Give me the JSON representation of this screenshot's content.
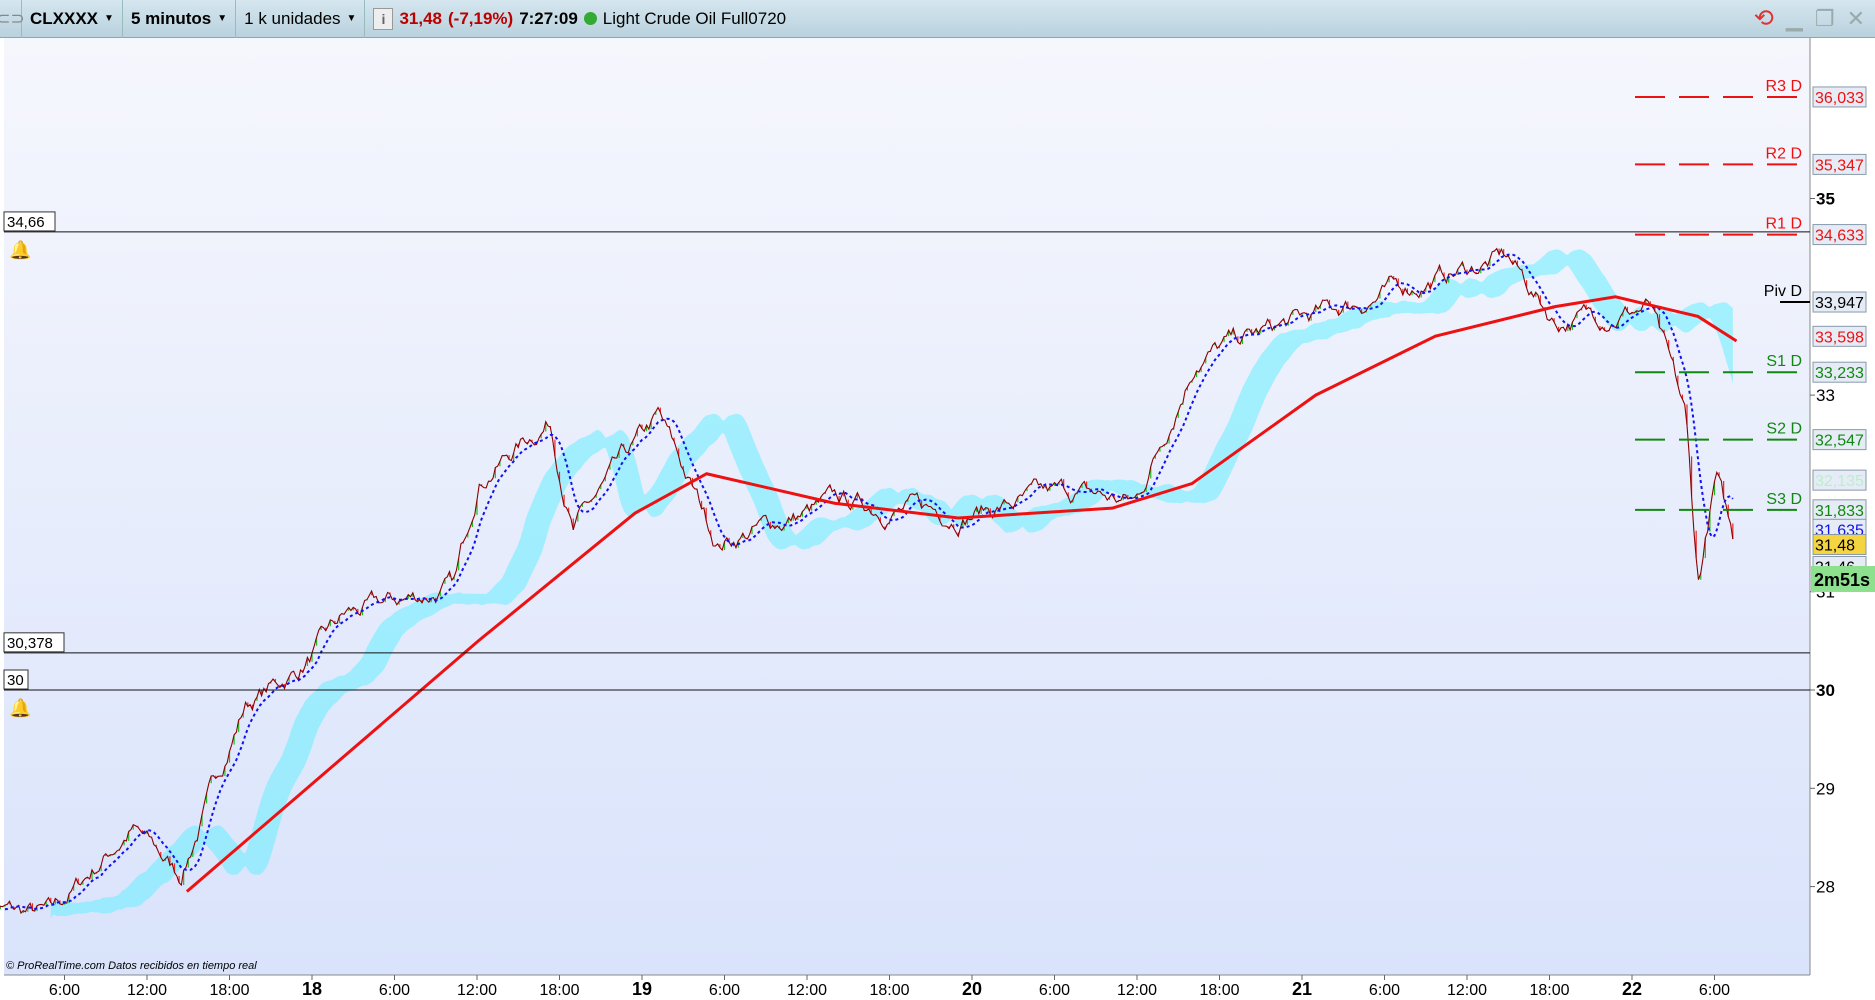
{
  "toolbar": {
    "instrument": "CLXXXX",
    "timeframe": "5 minutos",
    "units": "1 k unidades",
    "price": "31,48",
    "change": "(-7,19%)",
    "time": "7:27:09",
    "name": "Light Crude Oil Full0720"
  },
  "footer": {
    "copyright": "© ProRealTime.com",
    "realtime": "Datos recibidos en tiempo real"
  },
  "countdown": "2m51s",
  "colors": {
    "price": "#8b0000",
    "ma": "#ee1111",
    "tenkan": "#1111ee",
    "resistance": "#ee1111",
    "support": "#118811",
    "cloud_up": "#66eeff",
    "cloud_dn": "#88ee99"
  },
  "chart_data": {
    "type": "line",
    "x_unit": "hours since day 17 00:00",
    "x_ticks": [
      {
        "h": 6,
        "label": "6:00"
      },
      {
        "h": 12,
        "label": "12:00"
      },
      {
        "h": 18,
        "label": "18:00"
      },
      {
        "h": 24,
        "label": "18",
        "bold": true
      },
      {
        "h": 30,
        "label": "6:00"
      },
      {
        "h": 36,
        "label": "12:00"
      },
      {
        "h": 42,
        "label": "18:00"
      },
      {
        "h": 48,
        "label": "19",
        "bold": true
      },
      {
        "h": 54,
        "label": "6:00"
      },
      {
        "h": 60,
        "label": "12:00"
      },
      {
        "h": 66,
        "label": "18:00"
      },
      {
        "h": 72,
        "label": "20",
        "bold": true
      },
      {
        "h": 78,
        "label": "6:00"
      },
      {
        "h": 84,
        "label": "12:00"
      },
      {
        "h": 90,
        "label": "18:00"
      },
      {
        "h": 96,
        "label": "21",
        "bold": true
      },
      {
        "h": 102,
        "label": "6:00"
      },
      {
        "h": 108,
        "label": "12:00"
      },
      {
        "h": 114,
        "label": "18:00"
      },
      {
        "h": 120,
        "label": "22",
        "bold": true
      },
      {
        "h": 126,
        "label": "6:00"
      }
    ],
    "y_ticks": [
      {
        "v": 35,
        "label": "35",
        "bold": true
      },
      {
        "v": 33,
        "label": "33"
      },
      {
        "v": 31,
        "label": "31"
      },
      {
        "v": 30,
        "label": "30",
        "bold": true
      },
      {
        "v": 29,
        "label": "29"
      },
      {
        "v": 28,
        "label": "28"
      }
    ],
    "ylim": [
      27.1,
      37.8
    ],
    "price_series": [
      [
        0,
        27.8
      ],
      [
        1.7,
        27.75
      ],
      [
        5,
        27.7
      ],
      [
        10.9,
        28.6
      ],
      [
        14.4,
        28.1
      ],
      [
        19.1,
        29.85
      ],
      [
        23,
        30.2
      ],
      [
        26.5,
        30.75
      ],
      [
        34.4,
        31.05
      ],
      [
        36.1,
        32.15
      ],
      [
        41.3,
        32.75
      ],
      [
        43,
        31.65
      ],
      [
        49.2,
        32.75
      ],
      [
        53.5,
        31.5
      ],
      [
        62.2,
        31.9
      ],
      [
        70.9,
        31.8
      ],
      [
        79.6,
        32.0
      ],
      [
        83.9,
        31.9
      ],
      [
        88.3,
        33.4
      ],
      [
        92.6,
        33.6
      ],
      [
        101.3,
        34.0
      ],
      [
        110.9,
        34.4
      ],
      [
        114.4,
        33.75
      ],
      [
        121.3,
        33.9
      ],
      [
        123.9,
        32.75
      ],
      [
        124.8,
        31.05
      ],
      [
        126.1,
        32.15
      ],
      [
        127.4,
        31.48
      ]
    ],
    "ma_series": [
      [
        14.9,
        27.95
      ],
      [
        36.1,
        30.5
      ],
      [
        47.5,
        31.8
      ],
      [
        52.7,
        32.2
      ],
      [
        62,
        31.9
      ],
      [
        71,
        31.75
      ],
      [
        82.2,
        31.85
      ],
      [
        88,
        32.1
      ],
      [
        97,
        33.0
      ],
      [
        105.7,
        33.6
      ],
      [
        114.4,
        33.9
      ],
      [
        118.8,
        34.0
      ],
      [
        124.8,
        33.8
      ],
      [
        127.6,
        33.55
      ]
    ],
    "h_lines": [
      {
        "v": 34.66,
        "label": "34,66",
        "alert": true
      },
      {
        "v": 30.378,
        "label": "30,378",
        "alert": false
      },
      {
        "v": 30,
        "label": "30",
        "alert": true
      }
    ],
    "pivots": [
      {
        "v": 36.033,
        "name": "R3 D",
        "label": "36,033",
        "kind": "r"
      },
      {
        "v": 35.347,
        "name": "R2 D",
        "label": "35,347",
        "kind": "r"
      },
      {
        "v": 34.633,
        "name": "R1 D",
        "label": "34,633",
        "kind": "r"
      },
      {
        "v": 33.947,
        "name": "Piv D",
        "label": "33,947",
        "kind": "p"
      },
      {
        "v": 33.233,
        "name": "S1 D",
        "label": "33,233",
        "kind": "s"
      },
      {
        "v": 32.547,
        "name": "S2 D",
        "label": "32,547",
        "kind": "s"
      },
      {
        "v": 31.833,
        "name": "S3 D",
        "label": "31,833",
        "kind": "s"
      }
    ],
    "axis_markers": [
      {
        "v": 33.598,
        "label": "33,598",
        "color": "#ee1111"
      },
      {
        "v": 32.135,
        "label": "32,135",
        "color": "#bbeecc"
      },
      {
        "v": 31.635,
        "label": "31,635",
        "color": "#1111ee"
      },
      {
        "v": 31.48,
        "label": "31,48",
        "color": "#000",
        "bg": "#f5d442"
      },
      {
        "v": 31.46,
        "label": "31,46",
        "color": "#000"
      }
    ]
  }
}
